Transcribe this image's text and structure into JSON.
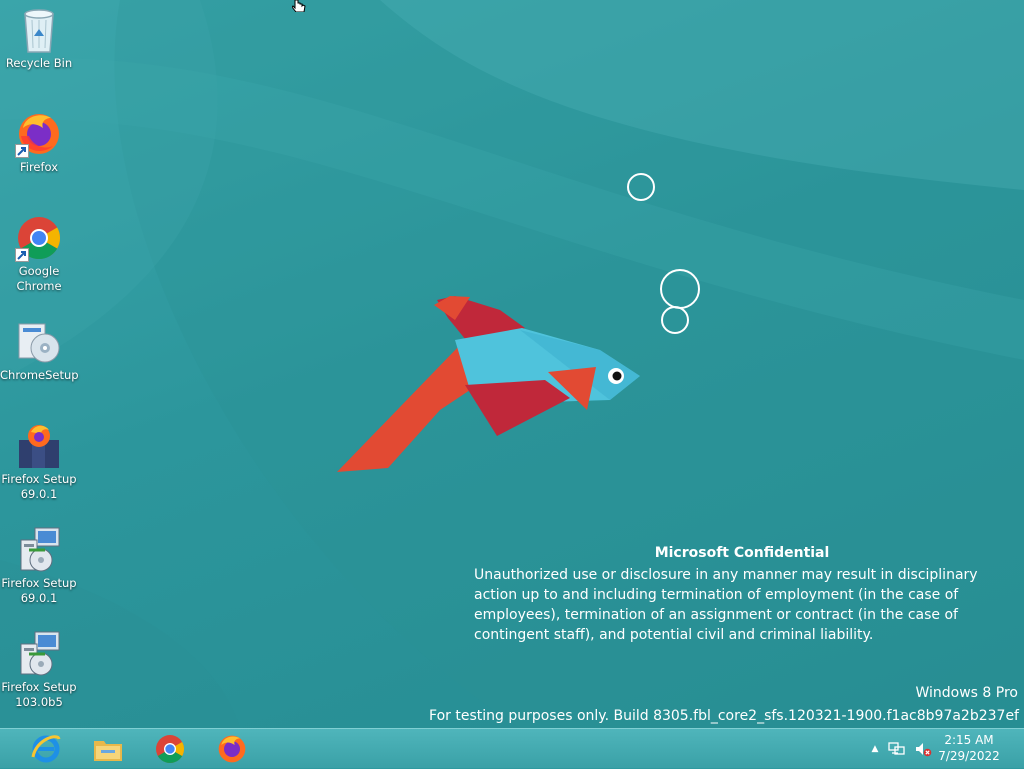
{
  "desktop": {
    "icons": [
      {
        "label": "Recycle Bin",
        "icon": "recycle-bin-icon"
      },
      {
        "label": "Firefox",
        "icon": "firefox-icon"
      },
      {
        "label": "Google Chrome",
        "icon": "chrome-icon"
      },
      {
        "label": "ChromeSetup",
        "icon": "chrome-setup-icon"
      },
      {
        "label": "Firefox Setup 69.0.1",
        "icon": "firefox-installer-icon"
      },
      {
        "label": "Firefox Setup 69.0.1",
        "icon": "msi-installer-icon"
      },
      {
        "label": "Firefox Setup 103.0b5",
        "icon": "msi-installer-icon"
      }
    ]
  },
  "watermark": {
    "title": "Microsoft Confidential",
    "body": "Unauthorized use or disclosure in any manner may result in disciplinary action up to and including termination of employment (in the case of employees), termination of an assignment or contract (in the case of contingent staff), and potential civil and criminal liability.",
    "edition": "Windows 8 Pro",
    "build": "For testing purposes only. Build 8305.fbl_core2_sfs.120321-1900.f1ac8b97a2b237ef"
  },
  "taskbar": {
    "pinned": [
      {
        "name": "Internet Explorer",
        "icon": "internet-explorer-icon"
      },
      {
        "name": "File Explorer",
        "icon": "file-explorer-icon"
      },
      {
        "name": "Google Chrome",
        "icon": "chrome-icon"
      },
      {
        "name": "Firefox",
        "icon": "firefox-icon"
      }
    ],
    "tray": {
      "icons": [
        "show-hidden-icons-icon",
        "network-icon",
        "volume-muted-icon"
      ],
      "time": "2:15 AM",
      "date": "7/29/2022"
    }
  },
  "colors": {
    "wallpaper": "#2f9aa0",
    "taskbar": "#45adb3",
    "fish_body": "#4fc3dc",
    "fish_fin_red": "#c0283a",
    "fish_tail": "#e24a33"
  }
}
